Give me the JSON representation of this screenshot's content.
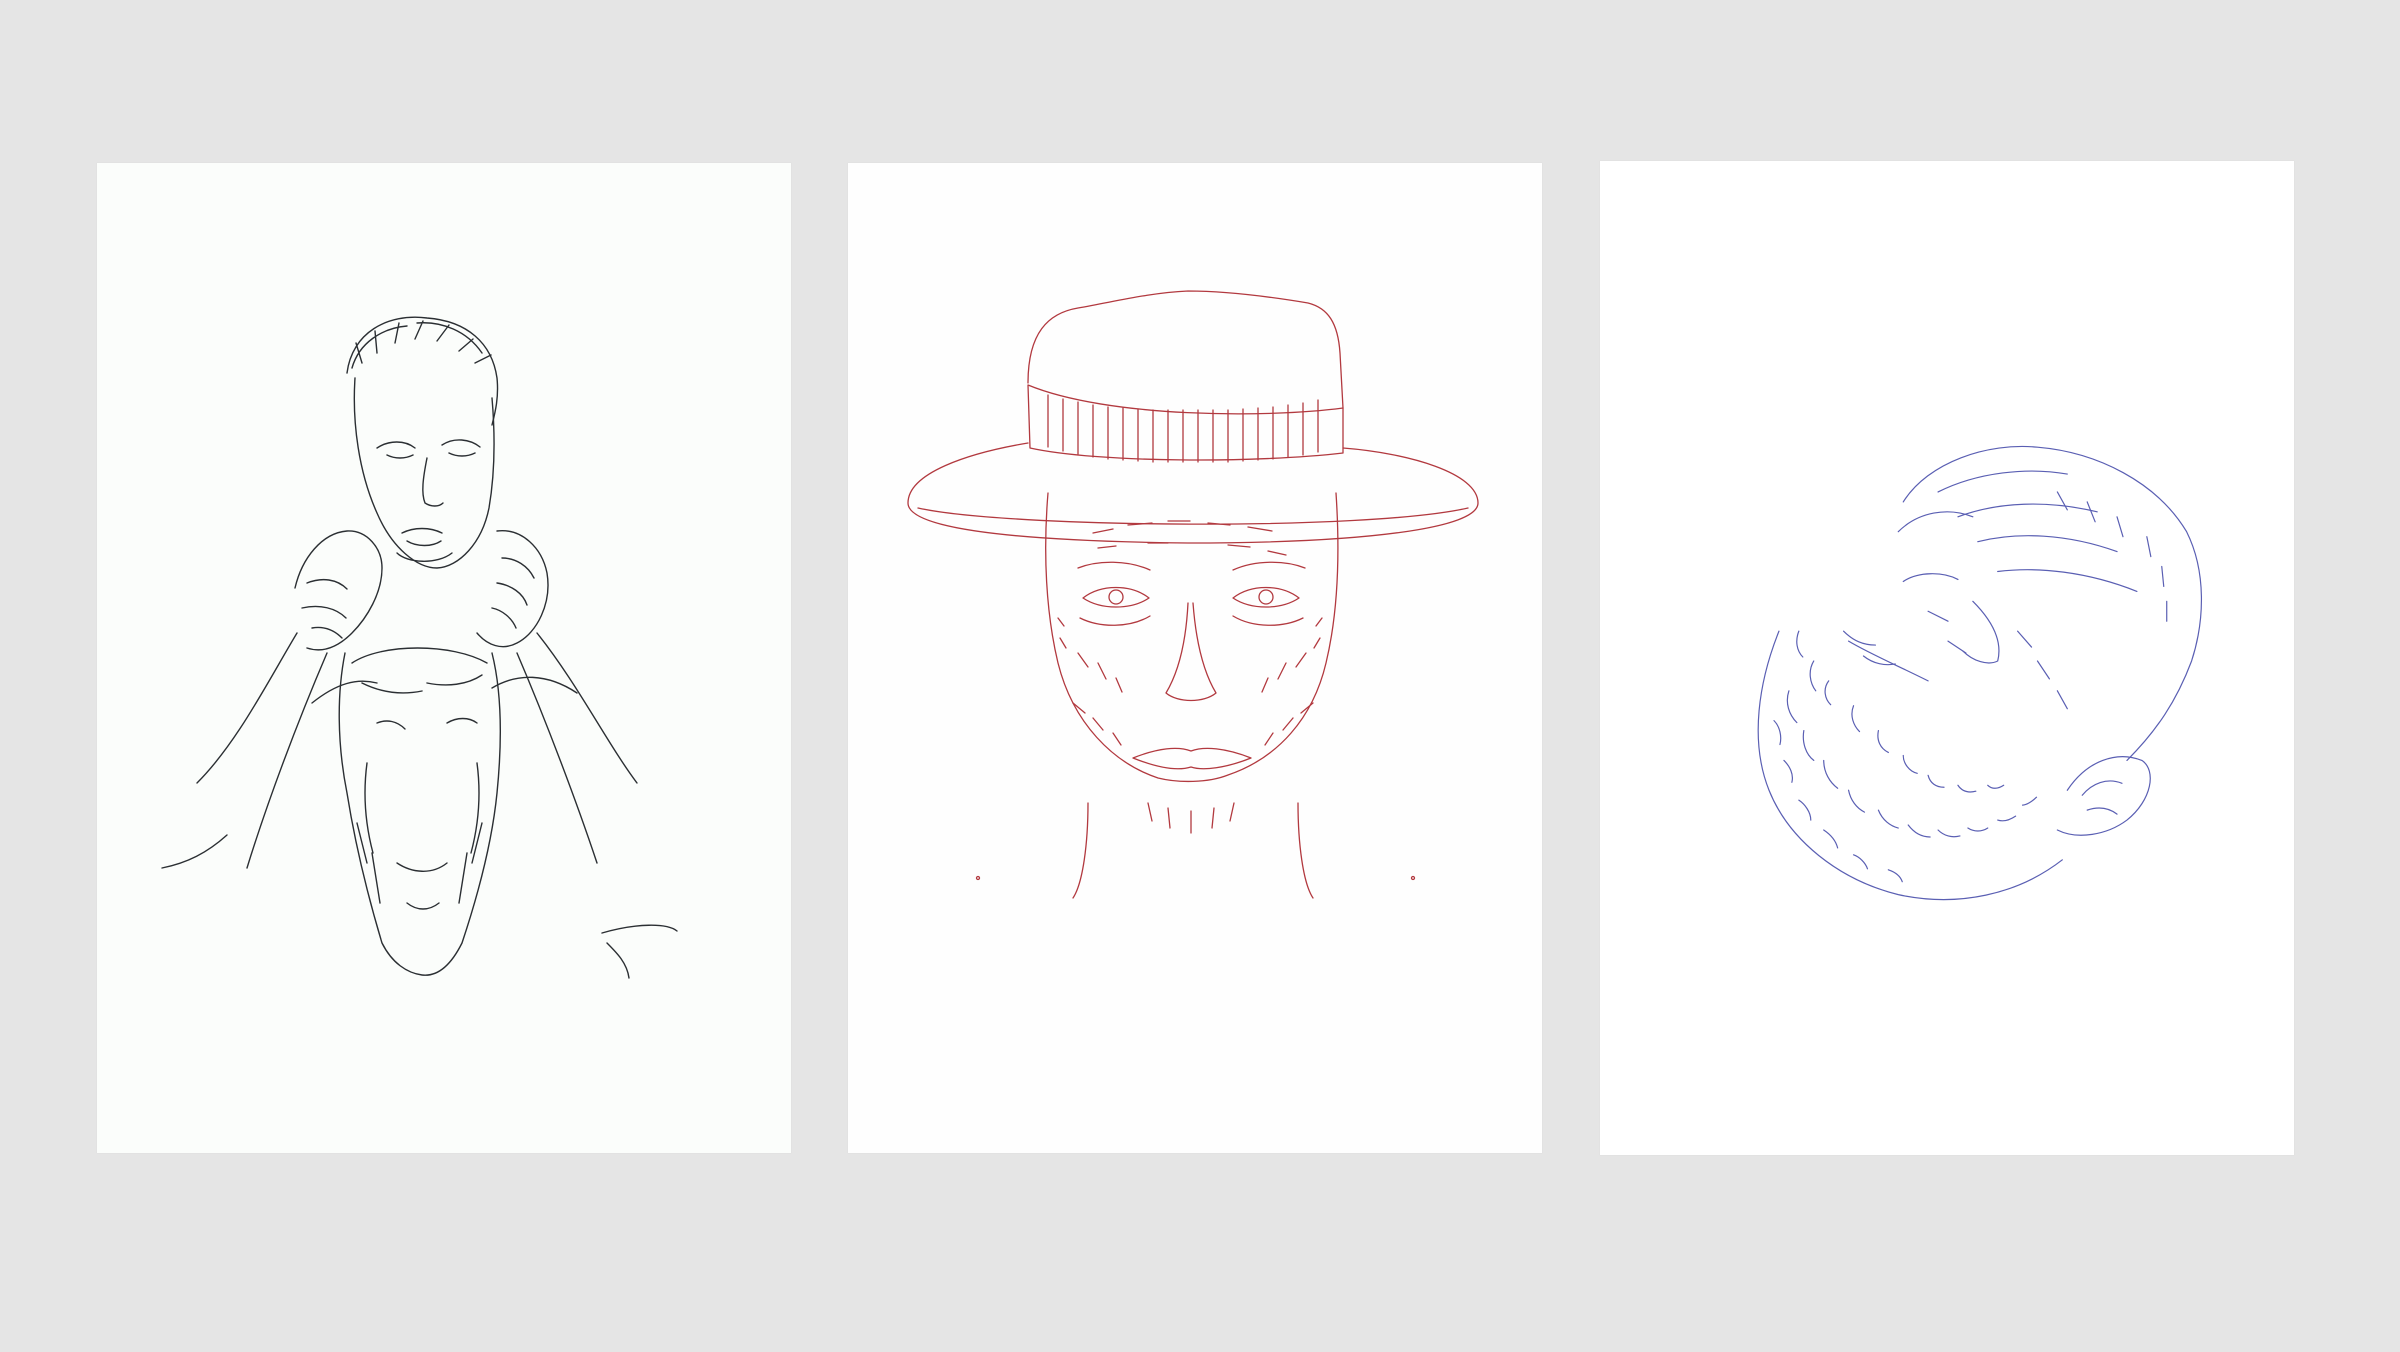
{
  "gallery": {
    "background_color": "#e5e5e5",
    "drawings": [
      {
        "subject": "man-holding-goat-head",
        "ink_color": "#2b2f33"
      },
      {
        "subject": "man-in-hat-portrait",
        "ink_color": "#b2393f"
      },
      {
        "subject": "bearded-bald-head",
        "ink_color": "#5a5fb3"
      }
    ]
  }
}
